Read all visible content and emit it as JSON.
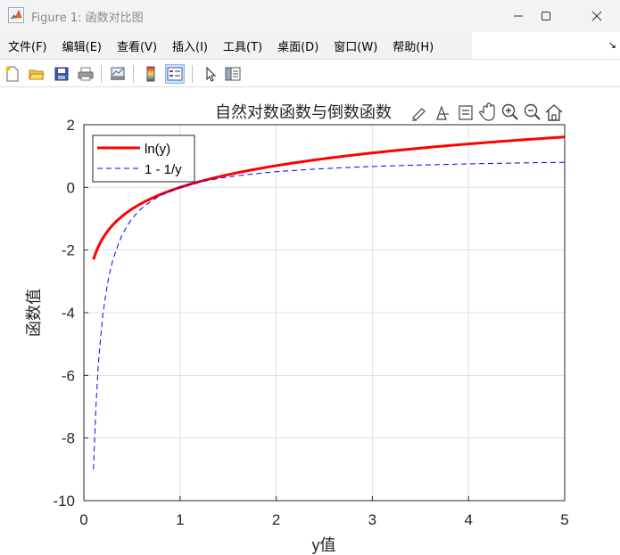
{
  "window": {
    "title": "Figure 1: 函数对比图"
  },
  "menu": {
    "items": [
      "文件(F)",
      "编辑(E)",
      "查看(V)",
      "插入(I)",
      "工具(T)",
      "桌面(D)",
      "窗口(W)",
      "帮助(H)"
    ]
  },
  "toolbar": {
    "icons": [
      "new-figure-icon",
      "open-file-icon",
      "save-icon",
      "print-icon",
      "link-plot-icon",
      "colorbar-icon",
      "legend-icon",
      "pointer-icon",
      "property-inspector-icon"
    ]
  },
  "axes_toolbar": {
    "icons": [
      "brush-icon",
      "data-tips-icon",
      "rotate-icon",
      "pan-icon",
      "zoom-in-icon",
      "zoom-out-icon",
      "home-icon"
    ]
  },
  "colors": {
    "ln_series": "#ff0000",
    "inv_series": "#0000ff",
    "grid": "#dfdfdf",
    "axis": "#262626"
  },
  "chart_data": {
    "type": "line",
    "title": "自然对数函数与倒数函数",
    "xlabel": "y值",
    "ylabel": "函数值",
    "xlim": [
      0,
      5
    ],
    "ylim": [
      -10,
      2
    ],
    "xticks": [
      0,
      1,
      2,
      3,
      4,
      5
    ],
    "yticks": [
      -10,
      -8,
      -6,
      -4,
      -2,
      0,
      2
    ],
    "grid": true,
    "legend_position": "top-left",
    "series": [
      {
        "name": "ln(y)",
        "style": "solid",
        "x": [
          0.1,
          0.15,
          0.2,
          0.3,
          0.4,
          0.5,
          0.6,
          0.8,
          1.0,
          1.25,
          1.5,
          2.0,
          2.5,
          3.0,
          3.5,
          4.0,
          4.5,
          5.0
        ],
        "y": [
          -2.303,
          -1.897,
          -1.609,
          -1.204,
          -0.916,
          -0.693,
          -0.511,
          -0.223,
          0.0,
          0.223,
          0.405,
          0.693,
          0.916,
          1.099,
          1.253,
          1.386,
          1.504,
          1.609
        ]
      },
      {
        "name": "1 - 1/y",
        "style": "dashed",
        "x": [
          0.1,
          0.12,
          0.15,
          0.2,
          0.25,
          0.3,
          0.4,
          0.5,
          0.6,
          0.8,
          1.0,
          1.25,
          1.5,
          2.0,
          2.5,
          3.0,
          3.5,
          4.0,
          4.5,
          5.0
        ],
        "y": [
          -9.0,
          -7.333,
          -5.667,
          -4.0,
          -3.0,
          -2.333,
          -1.5,
          -1.0,
          -0.667,
          -0.25,
          0.0,
          0.2,
          0.333,
          0.5,
          0.6,
          0.667,
          0.714,
          0.75,
          0.778,
          0.8
        ]
      }
    ]
  }
}
